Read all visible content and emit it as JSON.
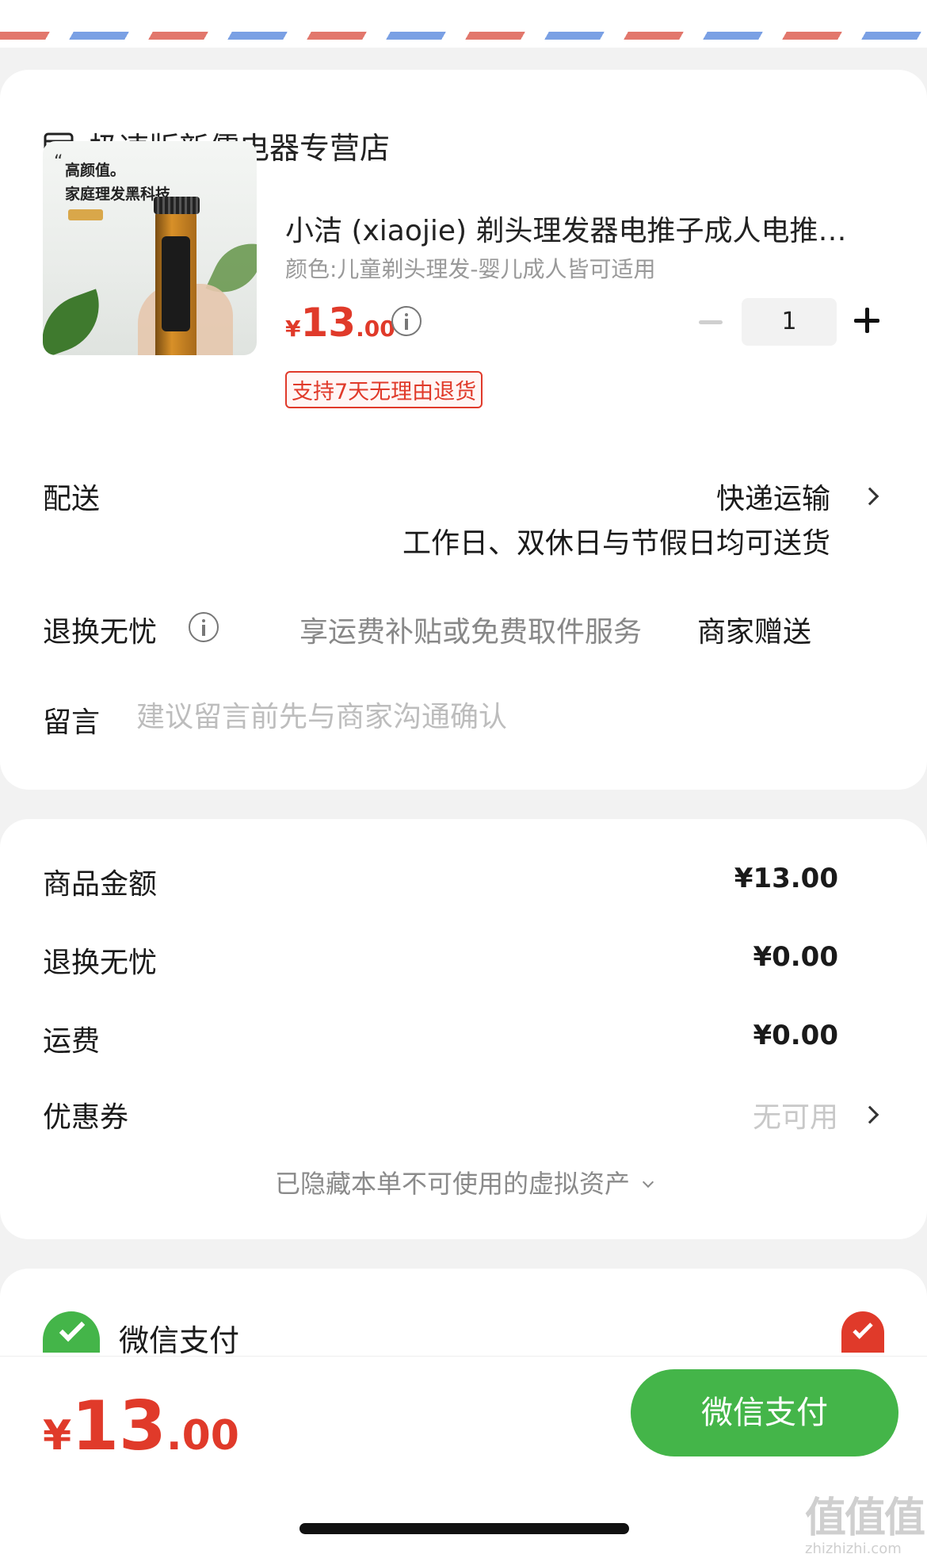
{
  "store": {
    "name": "极速版新儒电器专营店",
    "icon": "store-icon"
  },
  "product": {
    "image_caption_line1": "高颜值。",
    "image_caption_line2": "家庭理发黑科技",
    "title": "小洁 (xiaojie) 剃头理发器电推子成人电推…",
    "spec": "颜色:儿童剃头理发-婴儿成人皆可适用",
    "price_symbol": "¥",
    "price_int": "13",
    "price_dec": ".00",
    "quantity": "1",
    "return_tag": "支持7天无理由退货"
  },
  "shipping": {
    "label": "配送",
    "method": "快递运输",
    "detail": "工作日、双休日与节假日均可送货"
  },
  "worry_free": {
    "label": "退换无忧",
    "description": "享运费补贴或免费取件服务",
    "value": "商家赠送"
  },
  "message": {
    "label": "留言",
    "placeholder": "建议留言前先与商家沟通确认"
  },
  "amounts": [
    {
      "label": "商品金额",
      "value": "¥13.00"
    },
    {
      "label": "退换无忧",
      "value": "¥0.00"
    },
    {
      "label": "运费",
      "value": "¥0.00"
    }
  ],
  "coupon": {
    "label": "优惠券",
    "value": "无可用"
  },
  "hidden_assets": "已隐藏本单不可使用的虚拟资产",
  "payment": {
    "method_label": "微信支付",
    "selected": true
  },
  "bottom": {
    "price_symbol": "¥",
    "price_int": "13",
    "price_dec": ".00",
    "pay_button": "微信支付"
  },
  "colors": {
    "accent_red": "#e03a2a",
    "wechat_green": "#44b549"
  },
  "watermark": {
    "big": "值值值",
    "small": "zhizhizhi.com"
  }
}
